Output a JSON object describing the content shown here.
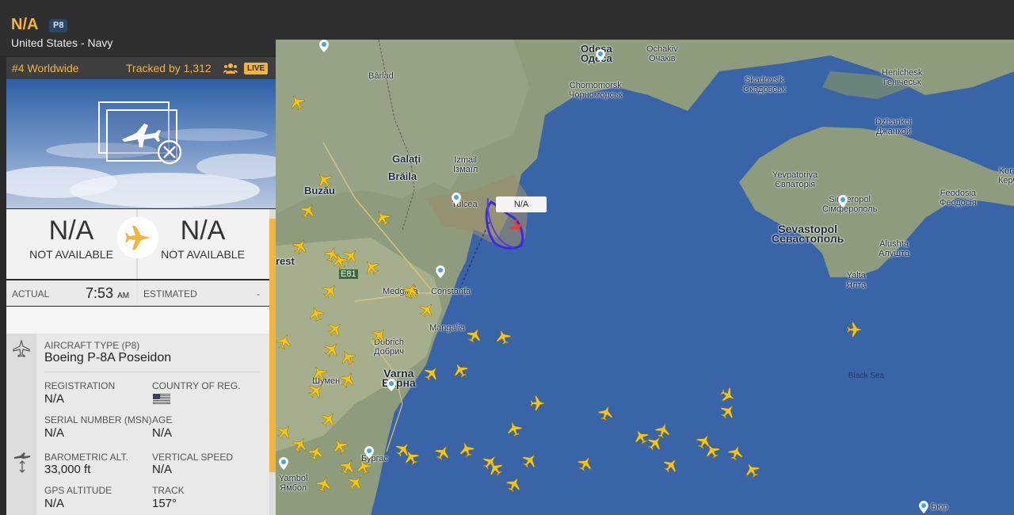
{
  "flight": {
    "callsign": "N/A",
    "type_code": "P8",
    "operator": "United States - Navy",
    "rank": "#4 Worldwide",
    "tracked_by": "Tracked by 1,312",
    "live_label": "LIVE"
  },
  "route": {
    "origin_code": "N/A",
    "origin_name": "NOT AVAILABLE",
    "dest_code": "N/A",
    "dest_name": "NOT AVAILABLE"
  },
  "times": {
    "actual_label": "ACTUAL",
    "actual_time": "7:53",
    "actual_ampm": "AM",
    "estimated_label": "ESTIMATED",
    "estimated_value": "-"
  },
  "details": {
    "aircraft_type_label": "AIRCRAFT TYPE",
    "aircraft_type_code": "(P8)",
    "aircraft_type_value": "Boeing P-8A Poseidon",
    "registration_label": "REGISTRATION",
    "registration_value": "N/A",
    "country_label": "COUNTRY OF REG.",
    "serial_label": "SERIAL NUMBER (MSN)",
    "serial_value": "N/A",
    "age_label": "AGE",
    "age_value": "N/A",
    "baro_label": "BAROMETRIC ALT.",
    "baro_value": "33,000 ft",
    "vspeed_label": "VERTICAL SPEED",
    "vspeed_value": "N/A",
    "gps_label": "GPS ALTITUDE",
    "gps_value": "N/A",
    "track_label": "TRACK",
    "track_value": "157°"
  },
  "map": {
    "selected_label": "N/A",
    "labels": {
      "odesa": "Odesa\nОдеса",
      "ochakiv": "Ochakiv\nОчаків",
      "chornomorsk": "Chornomorsk\nЧорноморськ",
      "skadovsk": "Skadovs'k\nСкадовськ",
      "henichesk": "Henichesk\nГенічеськ",
      "dzhankoi": "Dzhankoi\nДжанкой",
      "barlad": "Bârlad",
      "galati": "Galați",
      "braila": "Brăila",
      "izmail": "Izmail\nІзмаїл",
      "buzau": "Buzău",
      "tulcea": "Tulcea",
      "yevpatoriya": "Yevpatoriya\nЄвпаторія",
      "simferopol": "Simferopol\nСімферополь",
      "feodosia": "Feodosia\nФеодосія",
      "kerch": "Kerc\nКерч",
      "sevastopol": "Sevastopol\nСевастополь",
      "alushta": "Alushta\nАлушта",
      "yalta": "Yalta\nЯлта",
      "bucharest": "rest",
      "e81": "E81",
      "medgidia": "Medgidia",
      "constanta": "Constanța",
      "mangalia": "Mangalia",
      "dobrich": "Dobrich\nДобрич",
      "shumen": "Шумен",
      "varna": "Varna\nВарна",
      "burgas": "Бургас",
      "yambol": "Yambol\nЯмбол",
      "yamben": "Ямбол",
      "black_sea": "Black Sea",
      "bur": "Бюр"
    }
  },
  "colors": {
    "accent": "#f2b43c",
    "sea": "#3a64a8",
    "land": "#8a9a7a",
    "track": "#3b2be0",
    "header_bg": "#2f2f2f"
  }
}
